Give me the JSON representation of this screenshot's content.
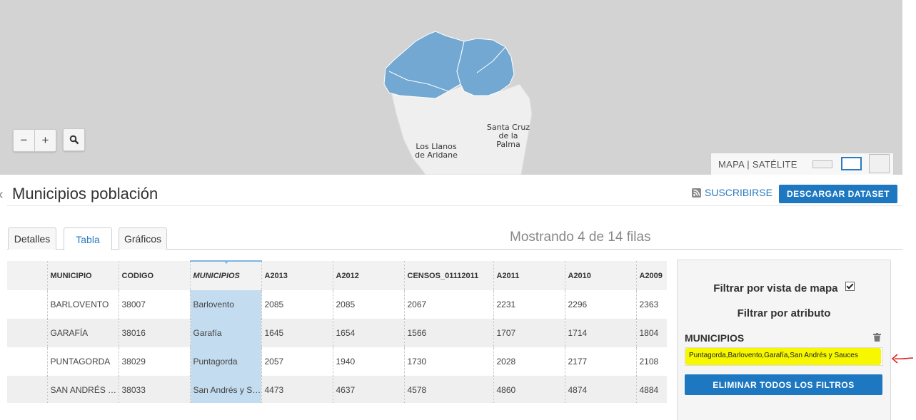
{
  "map": {
    "labels": {
      "los_llanos": "Los Llanos\nde Aridane",
      "santa_cruz": "Santa Cruz\nde la\nPalma"
    },
    "zoom_out": "−",
    "zoom_in": "+",
    "layer_switcher": "MAPA | SATÉLITE",
    "colors": {
      "background": "#d3d3d3",
      "land": "#efefef",
      "selected": "#72a8d2"
    }
  },
  "header": {
    "title": "Municipios población",
    "subscribe": "SUSCRIBIRSE",
    "download": "DESCARGAR DATASET"
  },
  "tabs": [
    {
      "label": "Detalles",
      "active": false
    },
    {
      "label": "Tabla",
      "active": true
    },
    {
      "label": "Gráficos",
      "active": false
    }
  ],
  "showing": "Mostrando 4 de 14 filas",
  "table": {
    "columns": [
      "",
      "MUNICIPIO",
      "CODIGO",
      "MUNICIPIOS",
      "A2013",
      "A2012",
      "CENSOS_01112011",
      "A2011",
      "A2010",
      "A2009"
    ],
    "rows": [
      [
        "",
        "BARLOVENTO",
        "38007",
        "Barlovento",
        "2085",
        "2085",
        "2067",
        "2231",
        "2296",
        "2363"
      ],
      [
        "",
        "GARAFÍA",
        "38016",
        "Garafía",
        "1645",
        "1654",
        "1566",
        "1707",
        "1714",
        "1804"
      ],
      [
        "",
        "PUNTAGORDA",
        "38029",
        "Puntagorda",
        "2057",
        "1940",
        "1730",
        "2028",
        "2177",
        "2108"
      ],
      [
        "",
        "SAN ANDRÉS Y SAUCES",
        "38033",
        "San Andrés y Sauces",
        "4473",
        "4637",
        "4578",
        "4860",
        "4874",
        "4884"
      ]
    ]
  },
  "filter": {
    "map_view": "Filtrar por vista de mapa",
    "by_attribute": "Filtrar por atributo",
    "field_label": "MUNICIPIOS",
    "field_value": "Puntagorda,Barlovento,Garafía,San Andrés y Sauces",
    "clear_all": "ELIMINAR TODOS LOS FILTROS",
    "highlight_color": "#f7f700"
  },
  "accent": "#1d78c1"
}
